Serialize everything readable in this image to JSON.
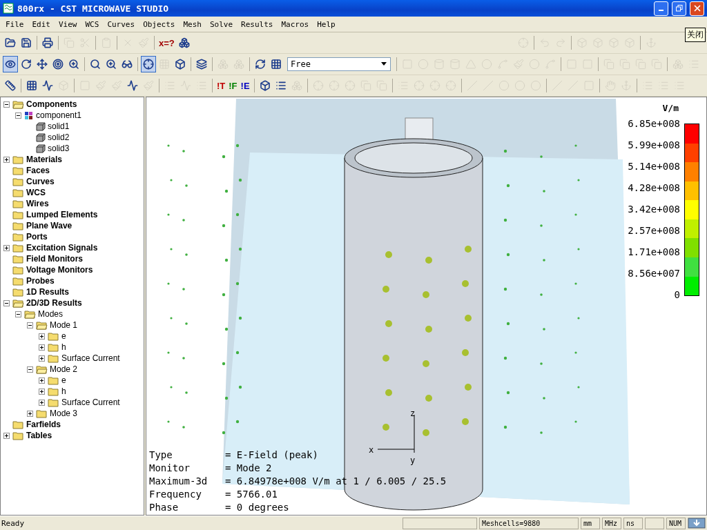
{
  "window": {
    "title": "800rx - CST MICROWAVE STUDIO"
  },
  "menu": [
    "File",
    "Edit",
    "View",
    "WCS",
    "Curves",
    "Objects",
    "Mesh",
    "Solve",
    "Results",
    "Macros",
    "Help"
  ],
  "tooltip": "关闭",
  "toolbars": [
    [
      {
        "kind": "open",
        "disabled": false
      },
      {
        "kind": "save",
        "disabled": false
      },
      {
        "kind": "sep"
      },
      {
        "kind": "print",
        "disabled": false
      },
      {
        "kind": "sep"
      },
      {
        "kind": "copy",
        "disabled": true
      },
      {
        "kind": "cut",
        "disabled": true
      },
      {
        "kind": "sep"
      },
      {
        "kind": "paste",
        "disabled": true
      },
      {
        "kind": "sep"
      },
      {
        "kind": "delete",
        "disabled": true
      },
      {
        "kind": "brush",
        "disabled": true
      },
      {
        "kind": "sep"
      },
      {
        "kind": "text",
        "label": "x=?",
        "color": "#a00000",
        "disabled": false
      },
      {
        "kind": "boxes",
        "disabled": false
      },
      {
        "kind": "gap"
      },
      {
        "kind": "axes",
        "disabled": true
      },
      {
        "kind": "sep"
      },
      {
        "kind": "undo",
        "disabled": true
      },
      {
        "kind": "redo",
        "disabled": true
      },
      {
        "kind": "sep"
      },
      {
        "kind": "box",
        "disabled": true
      },
      {
        "kind": "box",
        "disabled": true
      },
      {
        "kind": "box",
        "disabled": true
      },
      {
        "kind": "box",
        "disabled": true
      },
      {
        "kind": "sep"
      },
      {
        "kind": "anchor",
        "disabled": true
      }
    ],
    [
      {
        "kind": "eye",
        "disabled": false,
        "pressed": true
      },
      {
        "kind": "rotate",
        "disabled": false,
        "pressed": false
      },
      {
        "kind": "move",
        "disabled": false,
        "pressed": false
      },
      {
        "kind": "target",
        "disabled": false,
        "pressed": false
      },
      {
        "kind": "zoom",
        "disabled": false,
        "pressed": false
      },
      {
        "kind": "sep"
      },
      {
        "kind": "search",
        "disabled": false,
        "pressed": false
      },
      {
        "kind": "zoom",
        "disabled": false,
        "pressed": false
      },
      {
        "kind": "glasses",
        "disabled": false,
        "pressed": false
      },
      {
        "kind": "sep"
      },
      {
        "kind": "axes",
        "disabled": false,
        "pressed": true
      },
      {
        "kind": "grid",
        "disabled": true,
        "pressed": false
      },
      {
        "kind": "box",
        "disabled": false,
        "pressed": false
      },
      {
        "kind": "sep"
      },
      {
        "kind": "layers",
        "disabled": false,
        "pressed": false
      },
      {
        "kind": "sep"
      },
      {
        "kind": "boxes",
        "disabled": true,
        "pressed": false
      },
      {
        "kind": "boxes",
        "disabled": true,
        "pressed": false
      },
      {
        "kind": "sep"
      },
      {
        "kind": "refresh",
        "disabled": false,
        "pressed": false
      },
      {
        "kind": "grid",
        "disabled": false,
        "pressed": false
      },
      {
        "kind": "combo",
        "value": "Free"
      },
      {
        "kind": "sep"
      },
      {
        "kind": "square",
        "disabled": true,
        "pressed": false
      },
      {
        "kind": "circle",
        "disabled": true,
        "pressed": false
      },
      {
        "kind": "cylinder",
        "disabled": true,
        "pressed": false
      },
      {
        "kind": "cylinder",
        "disabled": true,
        "pressed": false
      },
      {
        "kind": "triangle",
        "disabled": true,
        "pressed": false
      },
      {
        "kind": "circle",
        "disabled": true,
        "pressed": false
      },
      {
        "kind": "spline",
        "disabled": true,
        "pressed": false
      },
      {
        "kind": "brush",
        "disabled": true,
        "pressed": false
      },
      {
        "kind": "circle",
        "disabled": true,
        "pressed": false
      },
      {
        "kind": "spline",
        "disabled": true,
        "pressed": false
      },
      {
        "kind": "sep"
      },
      {
        "kind": "square",
        "disabled": true,
        "pressed": false
      },
      {
        "kind": "square",
        "disabled": true,
        "pressed": false
      },
      {
        "kind": "sep"
      },
      {
        "kind": "copy",
        "disabled": true,
        "pressed": false
      },
      {
        "kind": "copy",
        "disabled": true,
        "pressed": false
      },
      {
        "kind": "copy",
        "disabled": true,
        "pressed": false
      },
      {
        "kind": "copy",
        "disabled": true,
        "pressed": false
      },
      {
        "kind": "sep"
      },
      {
        "kind": "boxes",
        "disabled": true,
        "pressed": false
      },
      {
        "kind": "list",
        "disabled": true,
        "pressed": false
      }
    ],
    [
      {
        "kind": "ruler",
        "disabled": false
      },
      {
        "kind": "sep"
      },
      {
        "kind": "grid",
        "disabled": false
      },
      {
        "kind": "wave",
        "disabled": false
      },
      {
        "kind": "box",
        "disabled": true
      },
      {
        "kind": "sep"
      },
      {
        "kind": "square",
        "disabled": true
      },
      {
        "kind": "brush",
        "disabled": true
      },
      {
        "kind": "brush",
        "disabled": true
      },
      {
        "kind": "wave",
        "disabled": false
      },
      {
        "kind": "brush",
        "disabled": true
      },
      {
        "kind": "sep"
      },
      {
        "kind": "list",
        "disabled": true
      },
      {
        "kind": "wave",
        "disabled": true
      },
      {
        "kind": "list",
        "disabled": true
      },
      {
        "kind": "sep"
      },
      {
        "kind": "text",
        "label": "!T",
        "color": "#c00000",
        "disabled": false
      },
      {
        "kind": "text",
        "label": "!F",
        "color": "#008000",
        "disabled": false
      },
      {
        "kind": "text",
        "label": "!E",
        "color": "#0000c0",
        "disabled": false
      },
      {
        "kind": "sep"
      },
      {
        "kind": "box",
        "disabled": false
      },
      {
        "kind": "list",
        "disabled": false
      },
      {
        "kind": "boxes",
        "disabled": true
      },
      {
        "kind": "sep"
      },
      {
        "kind": "axes",
        "disabled": true
      },
      {
        "kind": "axes",
        "disabled": true
      },
      {
        "kind": "axes",
        "disabled": true
      },
      {
        "kind": "copy",
        "disabled": true
      },
      {
        "kind": "copy",
        "disabled": true
      },
      {
        "kind": "sep"
      },
      {
        "kind": "list",
        "disabled": true
      },
      {
        "kind": "axes",
        "disabled": true
      },
      {
        "kind": "axes",
        "disabled": true
      },
      {
        "kind": "axes",
        "disabled": true
      },
      {
        "kind": "sep"
      },
      {
        "kind": "slash",
        "disabled": true
      },
      {
        "kind": "slash",
        "disabled": true
      },
      {
        "kind": "circle",
        "disabled": true
      },
      {
        "kind": "circle",
        "disabled": true
      },
      {
        "kind": "circle",
        "disabled": true
      },
      {
        "kind": "sep"
      },
      {
        "kind": "slash",
        "disabled": true
      },
      {
        "kind": "slash",
        "disabled": true
      },
      {
        "kind": "square",
        "disabled": true
      },
      {
        "kind": "sep"
      },
      {
        "kind": "hand",
        "disabled": true
      },
      {
        "kind": "anchor",
        "disabled": true
      },
      {
        "kind": "sep"
      },
      {
        "kind": "list",
        "disabled": true
      },
      {
        "kind": "list",
        "disabled": true
      },
      {
        "kind": "list",
        "disabled": true
      }
    ]
  ],
  "tree": [
    {
      "label": "Components",
      "kind": "folder",
      "expanded": true,
      "children": [
        {
          "label": "component1",
          "kind": "component",
          "expanded": true,
          "children": [
            {
              "label": "solid1",
              "kind": "solid"
            },
            {
              "label": "solid2",
              "kind": "solid"
            },
            {
              "label": "solid3",
              "kind": "solid"
            }
          ]
        }
      ]
    },
    {
      "label": "Materials",
      "kind": "folder",
      "expanded": false
    },
    {
      "label": "Faces",
      "kind": "folder"
    },
    {
      "label": "Curves",
      "kind": "folder"
    },
    {
      "label": "WCS",
      "kind": "folder"
    },
    {
      "label": "Wires",
      "kind": "folder"
    },
    {
      "label": "Lumped Elements",
      "kind": "folder"
    },
    {
      "label": "Plane Wave",
      "kind": "folder"
    },
    {
      "label": "Ports",
      "kind": "folder"
    },
    {
      "label": "Excitation Signals",
      "kind": "folder",
      "expanded": false
    },
    {
      "label": "Field Monitors",
      "kind": "folder"
    },
    {
      "label": "Voltage Monitors",
      "kind": "folder"
    },
    {
      "label": "Probes",
      "kind": "folder"
    },
    {
      "label": "1D Results",
      "kind": "folder"
    },
    {
      "label": "2D/3D Results",
      "kind": "folder",
      "expanded": true,
      "children": [
        {
          "label": "Modes",
          "kind": "folder",
          "expanded": true,
          "children": [
            {
              "label": "Mode 1",
              "kind": "folder",
              "expanded": true,
              "children": [
                {
                  "label": "e",
                  "kind": "folder",
                  "expanded": false
                },
                {
                  "label": "h",
                  "kind": "folder",
                  "expanded": false
                },
                {
                  "label": "Surface Current",
                  "kind": "folder",
                  "expanded": false
                }
              ]
            },
            {
              "label": "Mode 2",
              "kind": "folder",
              "expanded": true,
              "children": [
                {
                  "label": "e",
                  "kind": "folder",
                  "expanded": false
                },
                {
                  "label": "h",
                  "kind": "folder",
                  "expanded": false
                },
                {
                  "label": "Surface Current",
                  "kind": "folder",
                  "expanded": false
                }
              ]
            },
            {
              "label": "Mode 3",
              "kind": "folder",
              "expanded": false
            }
          ]
        }
      ]
    },
    {
      "label": "Farfields",
      "kind": "folder"
    },
    {
      "label": "Tables",
      "kind": "folder",
      "expanded": false
    }
  ],
  "viewport": {
    "axes": {
      "z": "z",
      "x": "x",
      "y": "y"
    },
    "legend": {
      "unit": "V/m",
      "ticks": [
        "6.85e+008",
        "5.99e+008",
        "5.14e+008",
        "4.28e+008",
        "3.42e+008",
        "2.57e+008",
        "1.71e+008",
        "8.56e+007",
        "0"
      ],
      "bands": [
        {
          "color": "#ff0000"
        },
        {
          "color": "#ff4000"
        },
        {
          "color": "#ff8000"
        },
        {
          "color": "#ffc000"
        },
        {
          "color": "#ffff00"
        },
        {
          "color": "#c0f000"
        },
        {
          "color": "#80e000"
        },
        {
          "color": "#40e040"
        },
        {
          "color": "#00ee00"
        }
      ]
    },
    "info": [
      {
        "label": "Type",
        "value": "= E-Field (peak)"
      },
      {
        "label": "Monitor",
        "value": "= Mode 2"
      },
      {
        "label": "Maximum-3d",
        "value": "= 6.84978e+008 V/m at 1 / 6.005 / 25.5"
      },
      {
        "label": "Frequency",
        "value": "= 5766.01"
      },
      {
        "label": "Phase",
        "value": "= 0 degrees"
      }
    ]
  },
  "status_bar": {
    "message": "Ready",
    "meshcells": "Meshcells=9880",
    "units": [
      "mm",
      "MHz",
      "ns"
    ],
    "num": "NUM"
  }
}
